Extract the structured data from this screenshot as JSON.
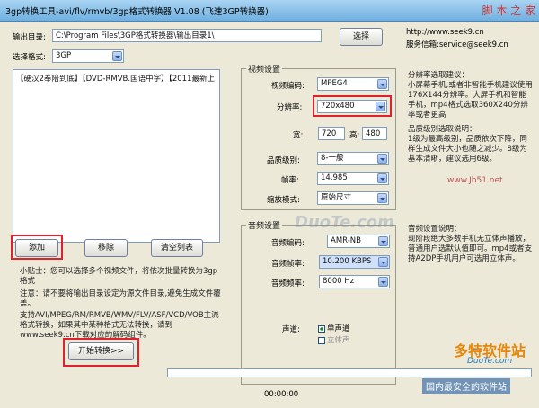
{
  "window": {
    "title": "3gp转换工具-avi/flv/rmvb/3gp格式转换器 V1.08 (飞速3GP转换器)",
    "watermark_site": "脚 本 之 家",
    "watermark_url": "www.Jb51.net"
  },
  "output": {
    "label": "输出目录:",
    "value": "C:\\Program Files\\3GP格式转换器\\输出目录1\\",
    "choose_btn": "选择"
  },
  "site": {
    "url": "http://www.seek9.cn",
    "email": "服务信箱:service@seek9.cn"
  },
  "format": {
    "label": "选择格式:",
    "value": "3GP"
  },
  "filelist": {
    "text": "【硬汉2奉陪到底】【DVD-RMVB.国语中字】【2011最新上"
  },
  "buttons": {
    "add": "添加",
    "remove": "移除",
    "clear": "清空列表",
    "start": "开始转换>>"
  },
  "tips": {
    "t1": "小贴士：您可以选择多个视频文件，将依次批量转换为3gp格式",
    "t2": "注意：请不要将输出目录设定为源文件目录,避免生成文件覆盖。",
    "t3": "支持AVI/MPEG/RM/RMVB/WMV/FLV/ASF/VCD/VOB主流格式转换，如果其中某种格式无法转换，请到www.seek9.cn下载对应的解码组件。"
  },
  "video": {
    "group": "视频设置",
    "codec_label": "视频编码:",
    "codec": "MPEG4",
    "res_label": "分辨率:",
    "res": "720x480",
    "w_label": "宽:",
    "w": "720",
    "h_label": "高:",
    "h": "480",
    "q_label": "品质级别:",
    "q": "8-一般",
    "fps_label": "帧率:",
    "fps": "14.985",
    "scale_label": "缩放模式:",
    "scale": "原始尺寸"
  },
  "audio": {
    "group": "音频设置",
    "codec_label": "音频编码:",
    "codec": "AMR-NB",
    "br_label": "音频帧率:",
    "br": "10.200 KBPS",
    "sr_label": "音频频率:",
    "sr": "8000 Hz",
    "ch_label": "声道:",
    "mono": "单声道",
    "stereo": "立体声"
  },
  "notes": {
    "res_title": "分辨率选取建议：",
    "res_body": "小屏幕手机,或者非智能手机建议使用176X144分辨率。大屏手机和智能手机，mp4格式选取360X240分辨率或者更高",
    "q_title": "品质级别选取说明：",
    "q_body": "1级为最高级别，品质依次下降，同样生成文件大小也随之减少。8级为基本清晰，建议选用6级。",
    "audio_title": "音频设置说明：",
    "audio_body": "现阶段绝大多数手机无立体声播放，普通用户选默认值即可。mp4或者支持A2DP手机用户可选用立体声。"
  },
  "status": {
    "time": "00:00:00",
    "progress": 0
  },
  "logos": {
    "watermark_mid": "DuoTe.com",
    "brand": "多特软件站",
    "brand_url": "DuoTe.com",
    "slogan": "国内最安全的软件站"
  },
  "colors": {
    "highlight": "#e0202a",
    "titlebar": "#6fb0e0"
  }
}
